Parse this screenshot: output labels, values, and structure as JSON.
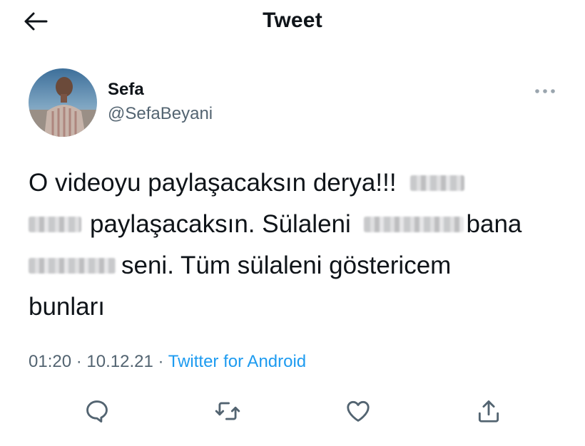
{
  "header": {
    "title": "Tweet"
  },
  "author": {
    "name": "Sefa",
    "handle": "@SefaBeyani"
  },
  "tweet": {
    "lines": [
      {
        "a": "O videoyu paylaşacaksın derya!!!",
        "b": ""
      },
      {
        "a": "paylaşacaksın. Sülaleni",
        "b": "bana"
      },
      {
        "a": "seni. Tüm sülaleni göstericem",
        "b": ""
      },
      {
        "a": "bunları",
        "b": ""
      }
    ],
    "time": "01:20",
    "date": "10.12.21",
    "separator": "·",
    "source": "Twitter for Android"
  },
  "icons": {
    "back": "back-arrow-icon",
    "more": "more-dots-icon",
    "reply": "reply-icon",
    "retweet": "retweet-icon",
    "like": "heart-icon",
    "share": "share-icon"
  },
  "colors": {
    "link": "#1d9bf0",
    "secondary": "#536471",
    "text": "#0f1419",
    "icon": "#536471"
  }
}
